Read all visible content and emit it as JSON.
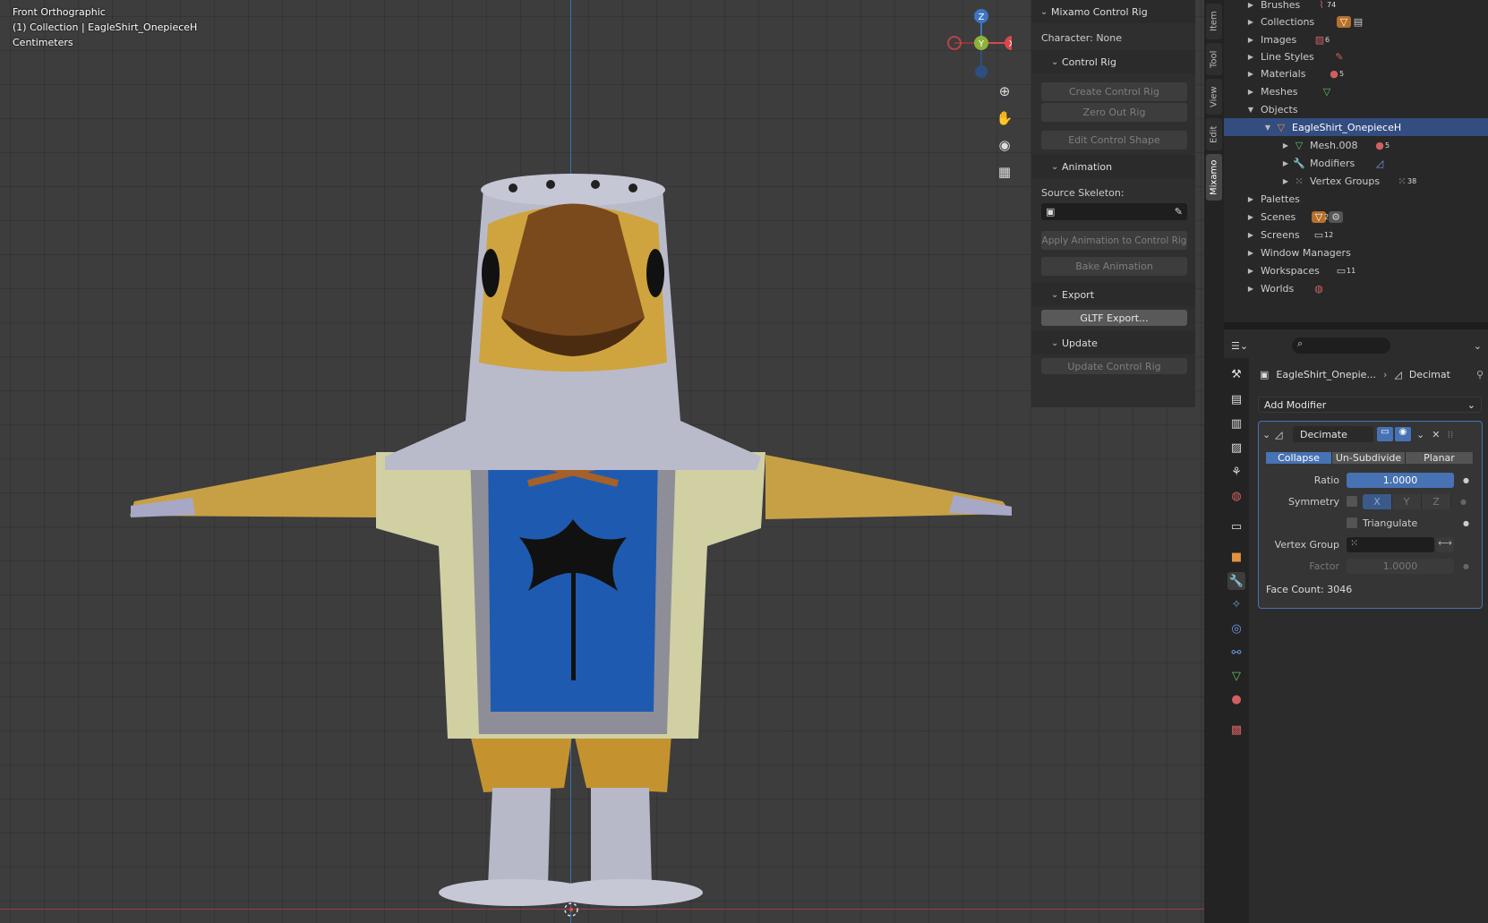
{
  "viewport": {
    "view_name": "Front Orthographic",
    "collection_info": "(1) Collection | EagleShirt_OnepieceH",
    "units": "Centimeters",
    "gizmo": {
      "z": "Z",
      "y": "Y",
      "x": "X"
    }
  },
  "npanel": {
    "title": "Mixamo Control Rig",
    "character_label": "Character: None",
    "control_rig_header": "Control Rig",
    "create_control_rig": "Create Control Rig",
    "zero_out_rig": "Zero Out Rig",
    "edit_control_shape": "Edit Control Shape",
    "animation_header": "Animation",
    "source_skeleton_label": "Source Skeleton:",
    "apply_animation": "Apply Animation to Control Rig",
    "bake_animation": "Bake Animation",
    "export_header": "Export",
    "gltf_export": "GLTF Export...",
    "update_header": "Update",
    "update_control_rig": "Update Control Rig"
  },
  "sidebar_tabs": [
    "Item",
    "Tool",
    "View",
    "Edit",
    "Mixamo"
  ],
  "outliner": {
    "items": [
      {
        "label": "Brushes",
        "count": "74",
        "level": 0
      },
      {
        "label": "Collections",
        "count": "",
        "level": 0
      },
      {
        "label": "Images",
        "count": "6",
        "level": 0
      },
      {
        "label": "Line Styles",
        "count": "",
        "level": 0
      },
      {
        "label": "Materials",
        "count": "5",
        "level": 0
      },
      {
        "label": "Meshes",
        "count": "",
        "level": 0
      },
      {
        "label": "Objects",
        "count": "",
        "level": 0
      },
      {
        "label": "EagleShirt_OnepieceH",
        "count": "",
        "level": 1
      },
      {
        "label": "Mesh.008",
        "count": "5",
        "level": 2
      },
      {
        "label": "Modifiers",
        "count": "",
        "level": 2
      },
      {
        "label": "Vertex Groups",
        "count": "38",
        "level": 2
      },
      {
        "label": "Palettes",
        "count": "",
        "level": 0
      },
      {
        "label": "Scenes",
        "count": "2",
        "level": 0
      },
      {
        "label": "Screens",
        "count": "12",
        "level": 0
      },
      {
        "label": "Window Managers",
        "count": "",
        "level": 0
      },
      {
        "label": "Workspaces",
        "count": "11",
        "level": 0
      },
      {
        "label": "Worlds",
        "count": "",
        "level": 0
      }
    ]
  },
  "properties": {
    "breadcrumb_object": "EagleShirt_Onepie...",
    "breadcrumb_modifier": "Decimat",
    "add_modifier": "Add Modifier",
    "modifier_name": "Decimate",
    "modes": [
      "Collapse",
      "Un-Subdivide",
      "Planar"
    ],
    "active_mode": "Collapse",
    "ratio_label": "Ratio",
    "ratio_value": "1.0000",
    "ratio_fraction": 1.0,
    "symmetry_label": "Symmetry",
    "axes": [
      "X",
      "Y",
      "Z"
    ],
    "triangulate_label": "Triangulate",
    "vertex_group_label": "Vertex Group",
    "factor_label": "Factor",
    "factor_value": "1.0000",
    "face_count": "Face Count: 3046"
  }
}
